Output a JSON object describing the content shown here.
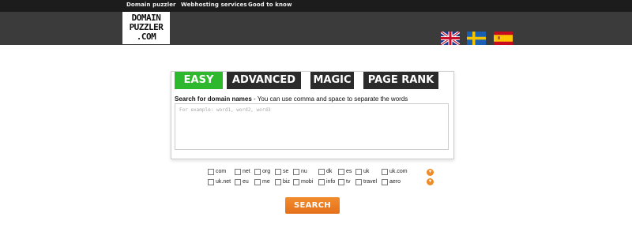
{
  "nav": {
    "links": [
      "Domain puzzler",
      "Webhosting services",
      "Good to know"
    ]
  },
  "logo": {
    "lines": [
      "DOMAIN",
      "PUZZLER",
      ".COM"
    ]
  },
  "languages": [
    {
      "name": "english-flag-icon"
    },
    {
      "name": "swedish-flag-icon"
    },
    {
      "name": "spanish-flag-icon"
    }
  ],
  "tabs": [
    {
      "label": "EASY",
      "active": true
    },
    {
      "label": "ADVANCED",
      "active": false
    },
    {
      "label": "MAGIC",
      "active": false
    },
    {
      "label": "PAGE RANK",
      "active": false
    }
  ],
  "search": {
    "heading_bold": "Search for domain names",
    "heading_rest": " - You can use comma and space to separate the words",
    "placeholder": "For example: word1, word2, word3",
    "button_label": "SEARCH"
  },
  "tlds_row1": [
    "com",
    "net",
    "org",
    "se",
    "nu",
    "dk",
    "es",
    "uk",
    "uk.com"
  ],
  "tlds_row2": [
    "uk.net",
    "eu",
    "me",
    "biz",
    "mobi",
    "info",
    "tv",
    "travel",
    "aero"
  ],
  "colors": {
    "topnav": "#1c1c1c",
    "header": "#3b3b3b",
    "tab_active": "#2eb82e",
    "tab_inactive": "#2b2b2b",
    "button": "#e97b22"
  }
}
